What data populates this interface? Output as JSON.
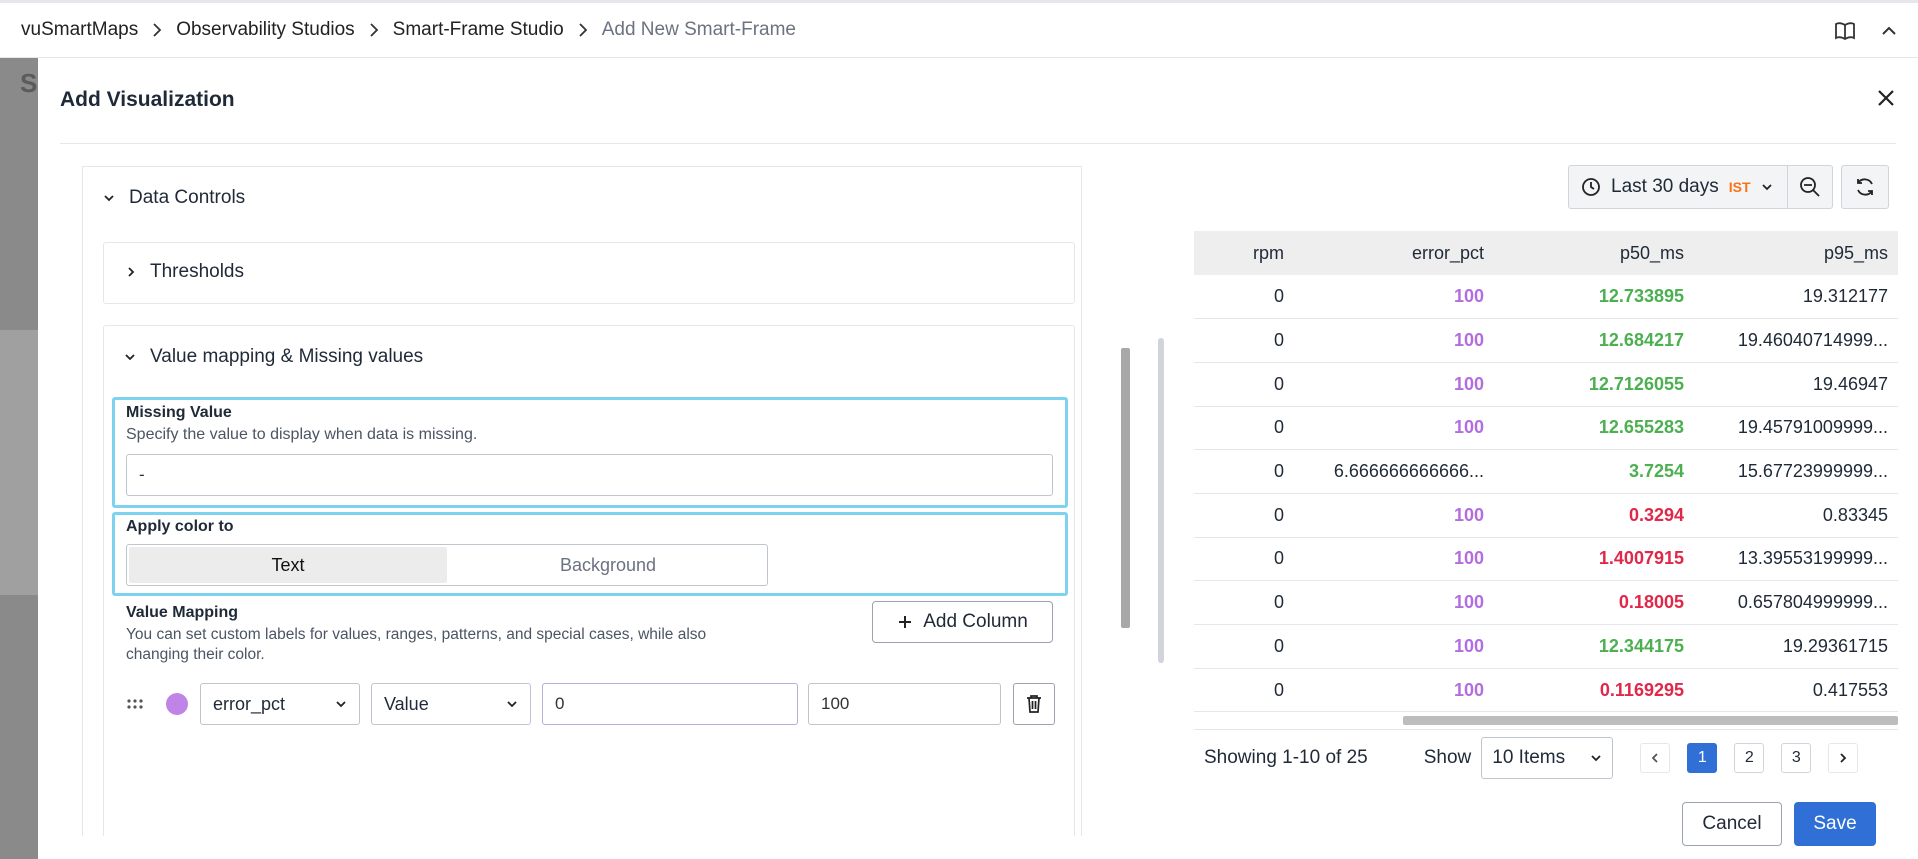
{
  "breadcrumb": {
    "items": [
      "vuSmartMaps",
      "Observability Studios",
      "Smart-Frame Studio",
      "Add New Smart-Frame"
    ]
  },
  "background": {
    "partial_letter": "S"
  },
  "modal": {
    "title": "Add Visualization",
    "cancel_label": "Cancel",
    "save_label": "Save"
  },
  "data_controls": {
    "title": "Data Controls",
    "thresholds_title": "Thresholds",
    "value_mapping_section_title": "Value mapping & Missing values",
    "missing_value": {
      "label": "Missing Value",
      "description": "Specify the value to display when data is missing.",
      "value": "-"
    },
    "apply_color": {
      "label": "Apply color to",
      "options": [
        "Text",
        "Background"
      ],
      "selected": "Text"
    },
    "value_mapping": {
      "label": "Value Mapping",
      "description_line1": "You can set custom labels for values, ranges, patterns, and special cases, while also",
      "description_line2": "changing their color.",
      "add_column_label": "Add Column",
      "row": {
        "color": "#c084e8",
        "column": "error_pct",
        "type": "Value",
        "from": "0",
        "to": "100"
      }
    }
  },
  "time_picker": {
    "label": "Last 30 days",
    "timezone": "IST"
  },
  "table": {
    "headers": [
      "rpm",
      "error_pct",
      "p50_ms",
      "p95_ms"
    ],
    "rows": [
      [
        "0",
        "100",
        "12.733895",
        "19.312177"
      ],
      [
        "0",
        "100",
        "12.684217",
        "19.46040714999..."
      ],
      [
        "0",
        "100",
        "12.7126055",
        "19.46947"
      ],
      [
        "0",
        "100",
        "12.655283",
        "19.45791009999..."
      ],
      [
        "0",
        "6.666666666666...",
        "3.7254",
        "15.67723999999..."
      ],
      [
        "0",
        "100",
        "0.3294",
        "0.83345"
      ],
      [
        "0",
        "100",
        "1.4007915",
        "13.39553199999..."
      ],
      [
        "0",
        "100",
        "0.18005",
        "0.657804999999..."
      ],
      [
        "0",
        "100",
        "12.344175",
        "19.29361715"
      ],
      [
        "0",
        "100",
        "0.1169295",
        "0.417553"
      ]
    ],
    "cell_colors": {
      "error_pct": [
        "purple",
        "purple",
        "purple",
        "purple",
        "plain",
        "purple",
        "purple",
        "purple",
        "purple",
        "purple"
      ],
      "p50_ms": [
        "green",
        "green",
        "green",
        "green",
        "green",
        "red",
        "red",
        "red",
        "green",
        "red"
      ]
    }
  },
  "pagination": {
    "summary": "Showing 1-10 of 25",
    "show_label": "Show",
    "page_size": "10 Items",
    "pages": [
      "1",
      "2",
      "3"
    ],
    "current_page": "1"
  },
  "colors": {
    "accent": "#2f6fd6",
    "highlight_border": "#7dd3ef",
    "purple_value": "#b26ee0",
    "green_value": "#4caf50",
    "red_value": "#e0284a",
    "timezone": "#f97316"
  }
}
